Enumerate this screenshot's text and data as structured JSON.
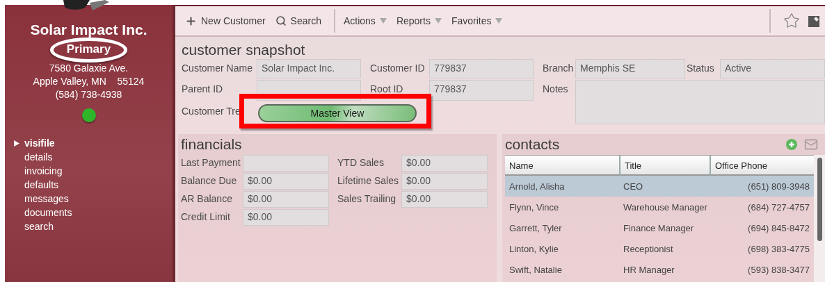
{
  "sidebar": {
    "company": "Solar Impact Inc.",
    "account_type": "Primary",
    "address_line": "7580 Galaxie Ave.",
    "city_line": "Apple Valley, MN    55124",
    "phone": "(584) 738-4938",
    "online": true,
    "nav": [
      {
        "label": "visifile",
        "selected": true
      },
      {
        "label": "details",
        "selected": false
      },
      {
        "label": "invoicing",
        "selected": false
      },
      {
        "label": "defaults",
        "selected": false
      },
      {
        "label": "messages",
        "selected": false
      },
      {
        "label": "documents",
        "selected": false
      },
      {
        "label": "search",
        "selected": false
      }
    ]
  },
  "toolbar": {
    "buttons": [
      {
        "label": "New Customer",
        "kind": "new"
      },
      {
        "label": "Search",
        "kind": "search"
      },
      {
        "label": "Actions",
        "kind": "menu"
      },
      {
        "label": "Reports",
        "kind": "menu"
      },
      {
        "label": "Favorites",
        "kind": "menu"
      }
    ]
  },
  "snapshot": {
    "title": "customer snapshot",
    "customer_name": {
      "label": "Customer Name",
      "value": "Solar Impact Inc."
    },
    "customer_id": {
      "label": "Customer ID",
      "value": "779837"
    },
    "branch": {
      "label": "Branch",
      "value": "Memphis SE"
    },
    "status": {
      "label": "Status",
      "value": "Active"
    },
    "parent_id": {
      "label": "Parent ID"
    },
    "root_id": {
      "label": "Root ID",
      "value": "779837"
    },
    "notes": {
      "label": "Notes"
    },
    "customer_tree": {
      "label": "Customer Tre",
      "button": "Master View"
    }
  },
  "financials": {
    "title": "financials",
    "left": [
      {
        "label": "Last Payment"
      },
      {
        "label": "Balance Due",
        "value": "$0.00"
      },
      {
        "label": "AR Balance",
        "value": "$0.00"
      },
      {
        "label": "Credit Limit",
        "value": "$0.00"
      }
    ],
    "right": [
      {
        "label": "YTD Sales",
        "value": "$0.00"
      },
      {
        "label": "Lifetime Sales",
        "value": "$0.00"
      },
      {
        "label": "Sales Trailing",
        "value": "$0.00"
      }
    ]
  },
  "contacts": {
    "title": "contacts",
    "columns": [
      "Name",
      "Title",
      "Office Phone"
    ],
    "rows": [
      {
        "name": "Arnold, Alisha",
        "title": "CEO",
        "phone": "(651) 809-3948",
        "selected": true
      },
      {
        "name": "Flynn, Vince",
        "title": "Warehouse Manager",
        "phone": "(684) 727-4757",
        "selected": false
      },
      {
        "name": "Garrett, Tyler",
        "title": "Finance Manager",
        "phone": "(694) 845-8472",
        "selected": false
      },
      {
        "name": "Linton, Kylie",
        "title": "Receptionist",
        "phone": "(698) 383-4775",
        "selected": false
      },
      {
        "name": "Swift, Natalie",
        "title": "HR Manager",
        "phone": "(593) 838-3477",
        "selected": false
      }
    ]
  }
}
